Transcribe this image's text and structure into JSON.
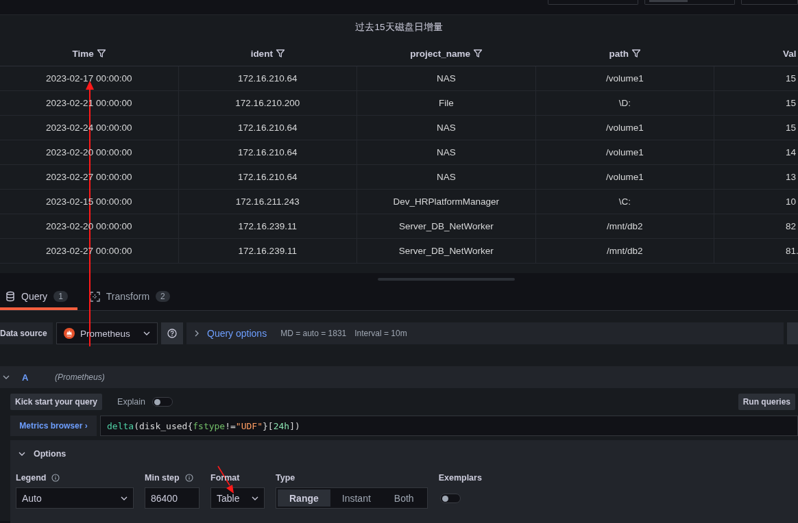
{
  "panel": {
    "title": "过去15天磁盘日增量",
    "columns": [
      "Time",
      "ident",
      "project_name",
      "path",
      "Val"
    ],
    "rows": [
      [
        "2023-02-17 00:00:00",
        "172.16.210.64",
        "NAS",
        "/volume1",
        "15"
      ],
      [
        "2023-02-21 00:00:00",
        "172.16.210.200",
        "File",
        "\\D:",
        "15"
      ],
      [
        "2023-02-24 00:00:00",
        "172.16.210.64",
        "NAS",
        "/volume1",
        "15"
      ],
      [
        "2023-02-20 00:00:00",
        "172.16.210.64",
        "NAS",
        "/volume1",
        "14"
      ],
      [
        "2023-02-27 00:00:00",
        "172.16.210.64",
        "NAS",
        "/volume1",
        "13"
      ],
      [
        "2023-02-15 00:00:00",
        "172.16.211.243",
        "Dev_HRPlatformManager",
        "\\C:",
        "10"
      ],
      [
        "2023-02-20 00:00:00",
        "172.16.239.11",
        "Server_DB_NetWorker",
        "/mnt/db2",
        "82"
      ],
      [
        "2023-02-27 00:00:00",
        "172.16.239.11",
        "Server_DB_NetWorker",
        "/mnt/db2",
        "81."
      ]
    ]
  },
  "tabs": [
    {
      "label": "Query",
      "count": "1",
      "selected": true,
      "kind": "query"
    },
    {
      "label": "Transform",
      "count": "2",
      "selected": false,
      "kind": "transform"
    }
  ],
  "data_source": {
    "label": "Data source",
    "value": "Prometheus"
  },
  "query_options": {
    "label": "Query options",
    "md": "MD = auto = 1831",
    "interval": "Interval = 10m"
  },
  "query": {
    "ref": "A",
    "datasource": "(Prometheus)",
    "kick_start": "Kick start your query",
    "explain": {
      "label": "Explain",
      "on": false
    },
    "run": "Run queries",
    "metrics_browser": "Metrics browser ›",
    "code": [
      {
        "kind": "function",
        "text": "delta"
      },
      {
        "kind": "plain",
        "text": "(disk_used{"
      },
      {
        "kind": "label",
        "text": "fstype"
      },
      {
        "kind": "plain",
        "text": "!="
      },
      {
        "kind": "string",
        "text": "\"UDF\""
      },
      {
        "kind": "plain",
        "text": "}["
      },
      {
        "kind": "number",
        "text": "24h"
      },
      {
        "kind": "plain",
        "text": "])"
      }
    ]
  },
  "options": {
    "title": "Options",
    "legend": {
      "label": "Legend",
      "value": "Auto"
    },
    "min_step": {
      "label": "Min step",
      "value": "86400"
    },
    "format": {
      "label": "Format",
      "value": "Table"
    },
    "type": {
      "label": "Type",
      "items": [
        {
          "label": "Range",
          "selected": true
        },
        {
          "label": "Instant",
          "selected": false
        },
        {
          "label": "Both",
          "selected": false
        }
      ]
    },
    "exemplars": {
      "label": "Exemplars",
      "on": false
    }
  }
}
